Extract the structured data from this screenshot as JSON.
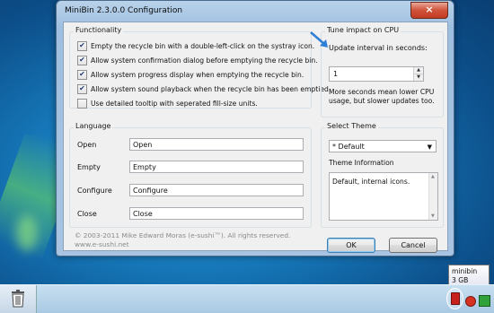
{
  "window": {
    "title": "MiniBin 2.3.0.0 Configuration",
    "close_glyph": "×"
  },
  "functionality": {
    "title": "Functionality",
    "options": [
      {
        "label": "Empty the recycle bin with a double-left-click on the systray icon.",
        "checked": true
      },
      {
        "label": "Allow system confirmation dialog before emptying the recycle bin.",
        "checked": true
      },
      {
        "label": "Allow system progress display when emptying the recycle bin.",
        "checked": true
      },
      {
        "label": "Allow system sound playback when the recycle bin has been emptied.",
        "checked": true
      },
      {
        "label": "Use detailed tooltip with seperated fill-size units.",
        "checked": false
      }
    ]
  },
  "cpu": {
    "title": "Tune impact on CPU",
    "interval_label": "Update interval in seconds:",
    "interval_value": "1",
    "note_line1": "More seconds mean lower CPU",
    "note_line2": "usage, but slower updates too."
  },
  "language": {
    "title": "Language",
    "rows": [
      {
        "label": "Open",
        "value": "Open"
      },
      {
        "label": "Empty",
        "value": "Empty"
      },
      {
        "label": "Configure",
        "value": "Configure"
      },
      {
        "label": "Close",
        "value": "Close"
      }
    ]
  },
  "theme": {
    "title": "Select Theme",
    "selected": "* Default",
    "info_label": "Theme Information",
    "info_text": "Default, internal icons."
  },
  "footer": {
    "copyright": "© 2003-2011 Mike Edward Moras (e-sushi™). All rights reserved.",
    "website": "www.e-sushi.net"
  },
  "buttons": {
    "ok": "OK",
    "cancel": "Cancel"
  },
  "tooltip": {
    "line1": "minibin",
    "line2": "3 GB"
  },
  "colors": {
    "arrow": "#2d7fd8"
  }
}
